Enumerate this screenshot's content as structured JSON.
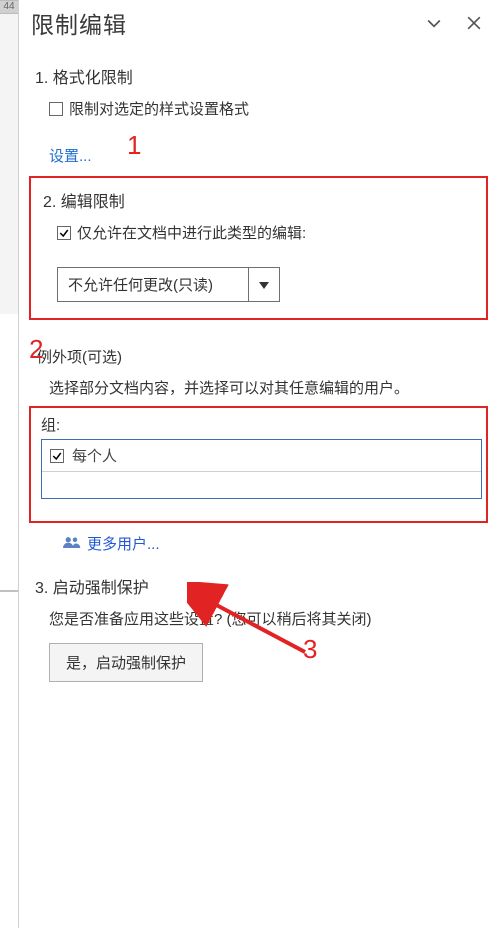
{
  "panel_title": "限制编辑",
  "section1": {
    "head": "1. 格式化限制",
    "checkbox_label": "限制对选定的样式设置格式",
    "settings_link": "设置..."
  },
  "section2": {
    "head": "2. 编辑限制",
    "checkbox_label": "仅允许在文档中进行此类型的编辑:",
    "dropdown_value": "不允许任何更改(只读)",
    "exceptions_head": "例外项(可选)",
    "exceptions_desc": "选择部分文档内容，并选择可以对其任意编辑的用户。",
    "groups_label": "组:",
    "group_everyone": "每个人",
    "more_users": "更多用户..."
  },
  "section3": {
    "head": "3. 启动强制保护",
    "desc": "您是否准备应用这些设置? (您可以稍后将其关闭)",
    "button": "是，启动强制保护"
  },
  "annotations": {
    "n1": "1",
    "n2": "2",
    "n3": "3"
  },
  "behind_ruler_label": "44"
}
